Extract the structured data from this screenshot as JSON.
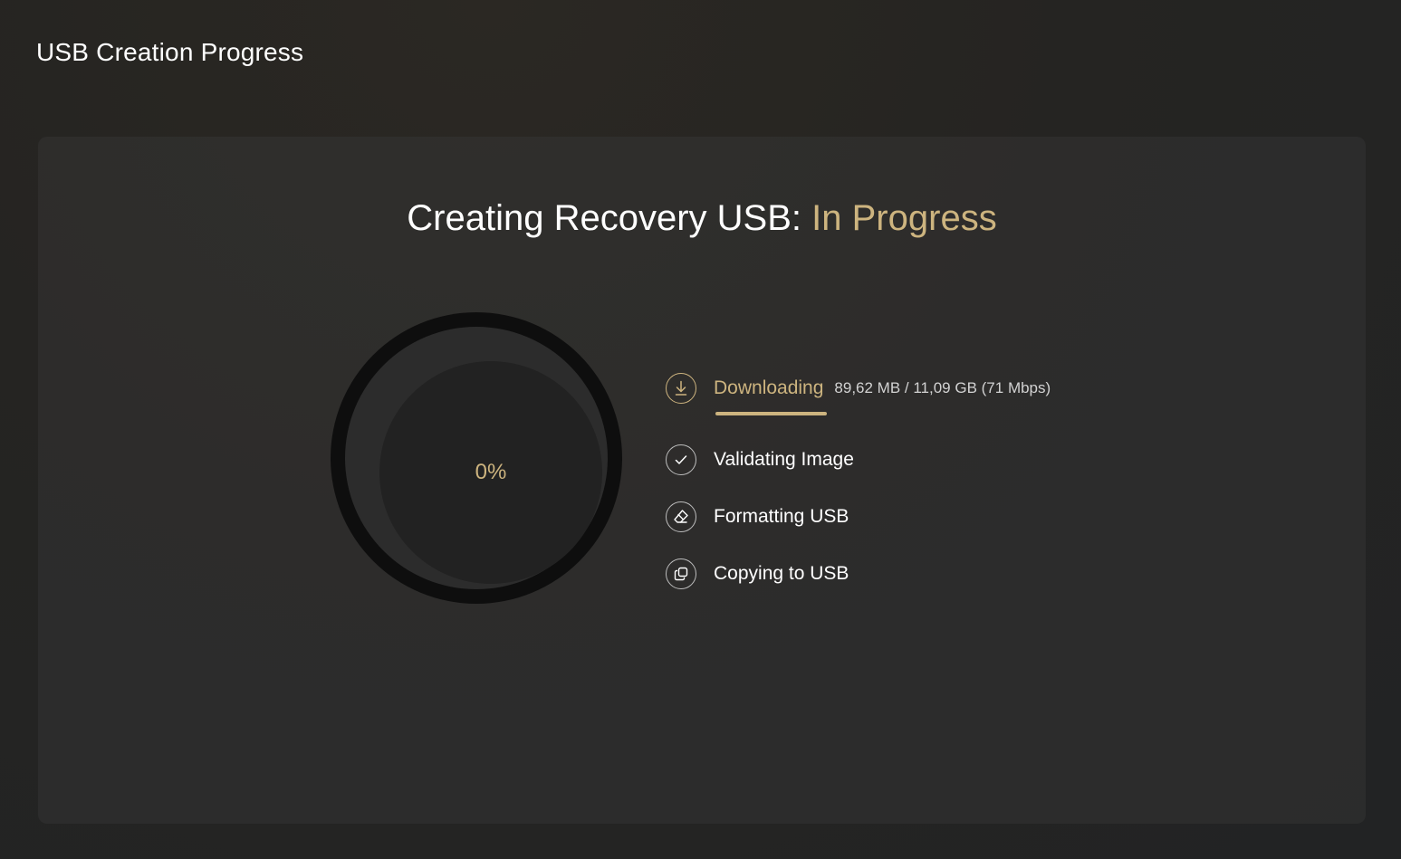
{
  "window": {
    "title": "USB Creation Progress"
  },
  "main": {
    "headline_prefix": "Creating Recovery USB:",
    "headline_status": "In Progress",
    "progress_percent_label": "0%",
    "progress_value": 0
  },
  "steps": [
    {
      "label": "Downloading",
      "detail": "89,62 MB / 11,09 GB (71 Mbps)",
      "icon": "download-icon",
      "active": true
    },
    {
      "label": "Validating Image",
      "icon": "checkmark-icon",
      "active": false
    },
    {
      "label": "Formatting USB",
      "icon": "eraser-icon",
      "active": false
    },
    {
      "label": "Copying to USB",
      "icon": "copy-icon",
      "active": false
    }
  ],
  "colors": {
    "accent": "#cdb47f",
    "text": "#ffffff",
    "ring_outer": "#0e0e0e",
    "ring_inner": "#222222"
  }
}
